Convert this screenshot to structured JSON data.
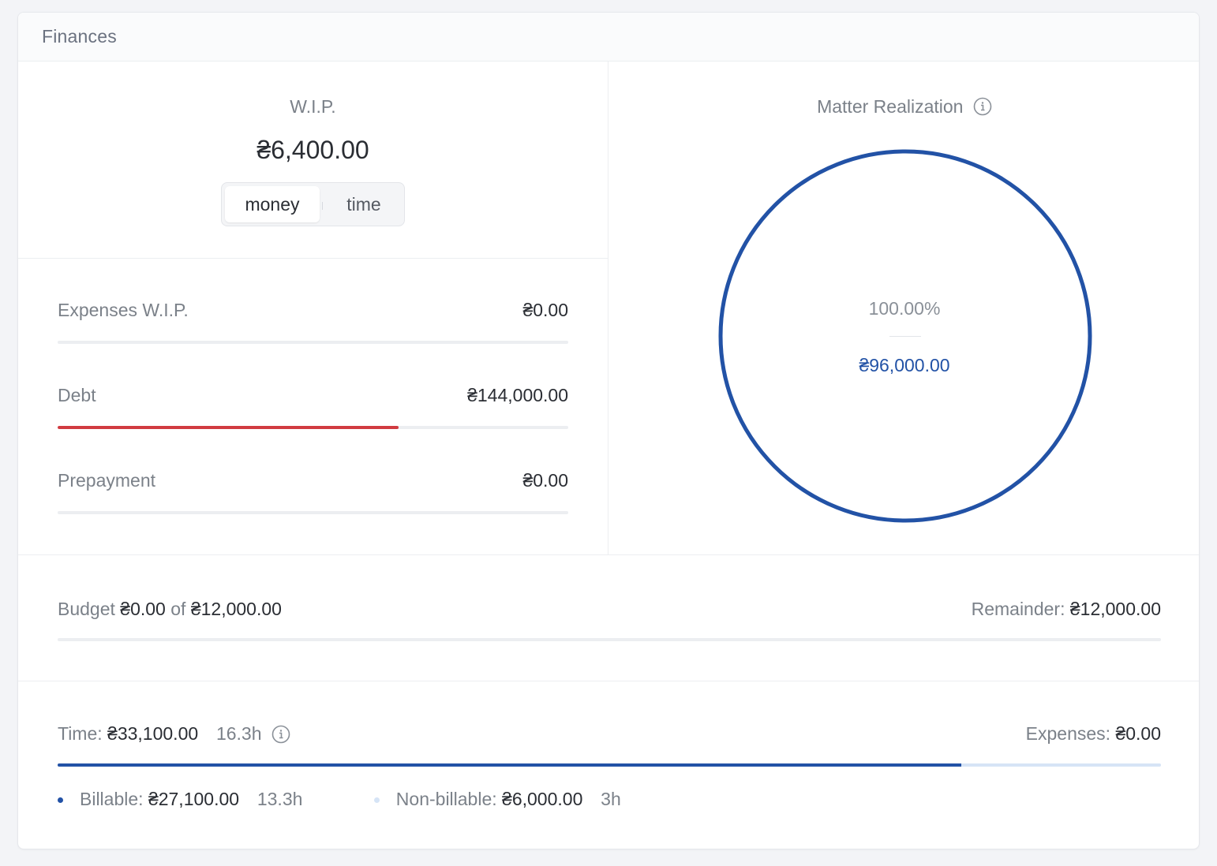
{
  "card": {
    "title": "Finances"
  },
  "wip": {
    "label": "W.I.P.",
    "value": "₴6,400.00",
    "toggle": {
      "active": "money",
      "inactive": "time"
    }
  },
  "stats": [
    {
      "label": "Expenses W.I.P.",
      "value": "₴0.00",
      "fill": 0,
      "color": "#d13b40"
    },
    {
      "label": "Debt",
      "value": "₴144,000.00",
      "fill": 0.667,
      "color": "#d13b40"
    },
    {
      "label": "Prepayment",
      "value": "₴0.00",
      "fill": 0,
      "color": "#d13b40"
    }
  ],
  "realization": {
    "title": "Matter Realization",
    "info_icon": "info-icon",
    "percent": "100.00%",
    "percent_value": 100,
    "amount": "₴96,000.00",
    "ring_color": "#2252a6"
  },
  "budget": {
    "label": "Budget",
    "spent": "₴0.00",
    "of": "of",
    "total": "₴12,000.00",
    "remainder_label": "Remainder:",
    "remainder": "₴12,000.00",
    "fill": 0
  },
  "time": {
    "label": "Time:",
    "amount": "₴33,100.00",
    "hours": "16.3h",
    "info_icon": "info-icon",
    "expenses_label": "Expenses:",
    "expenses": "₴0.00",
    "fill": 0.8187,
    "billable": {
      "label": "Billable:",
      "amount": "₴27,100.00",
      "hours": "13.3h",
      "color": "#2252a6"
    },
    "non_billable": {
      "label": "Non-billable:",
      "amount": "₴6,000.00",
      "hours": "3h",
      "color": "#d6e4f6"
    }
  }
}
